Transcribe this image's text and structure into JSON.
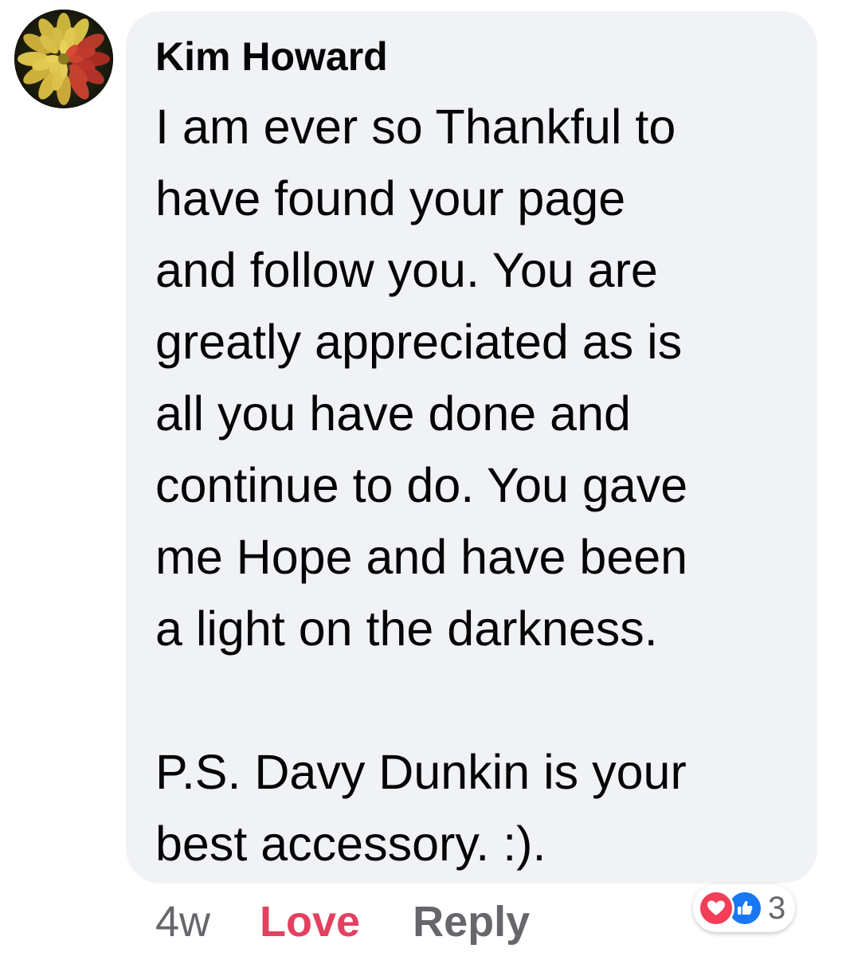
{
  "comment": {
    "author": "Kim Howard",
    "text_lines": [
      "I am ever so Thankful to",
      "have found your page",
      "and follow you. You are",
      "greatly appreciated as is",
      "all you have done and",
      "continue to do. You gave",
      "me Hope and have been",
      "a light on the darkness."
    ],
    "ps_lines": [
      "P.S. Davy Dunkin is your",
      "best accessory. :)."
    ],
    "avatar_icon": "dahlia-flower-avatar"
  },
  "actions": {
    "time": "4w",
    "love_label": "Love",
    "reply_label": "Reply"
  },
  "reactions": {
    "icons": [
      "heart-icon",
      "thumbs-up-icon"
    ],
    "count": "3",
    "colors": {
      "love": "#f33e58",
      "like": "#1877f2",
      "love_action": "#e4405f"
    }
  }
}
